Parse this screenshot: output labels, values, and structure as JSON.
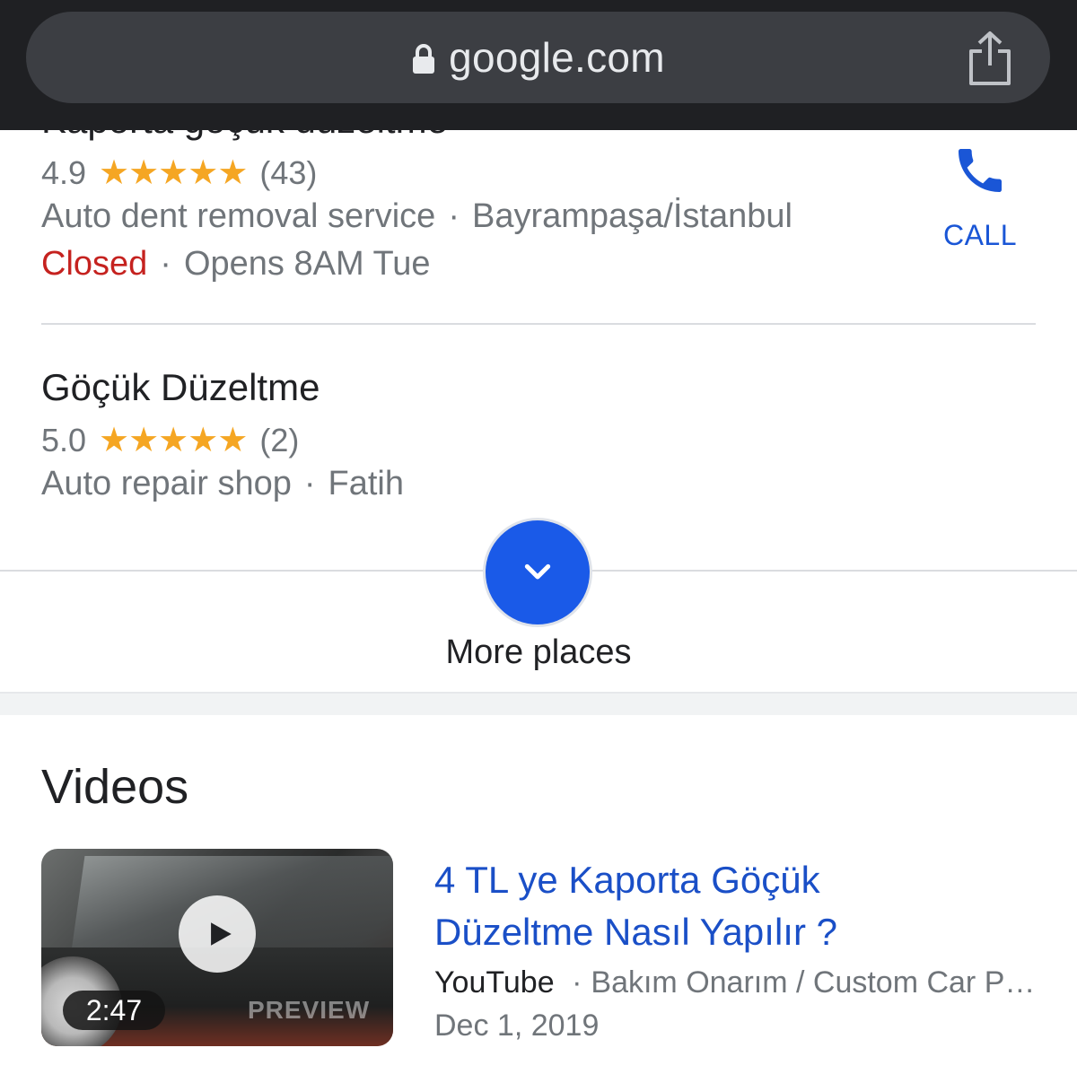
{
  "browser": {
    "url": "google.com"
  },
  "places": {
    "first": {
      "name": "Kaporta göçük düzeltme",
      "rating": "4.9",
      "stars": "★★★★★",
      "reviews": "(43)",
      "category": "Auto dent removal service",
      "location": "Bayrampaşa/İstanbul",
      "status": "Closed",
      "hours": "Opens 8AM Tue",
      "call_label": "CALL"
    },
    "second": {
      "name": "Göçük Düzeltme",
      "rating": "5.0",
      "stars": "★★★★★",
      "reviews": "(2)",
      "category": "Auto repair shop",
      "location": "Fatih"
    },
    "separator": "·",
    "more_label": "More places"
  },
  "videos": {
    "heading": "Videos",
    "items": [
      {
        "title": "4 TL ye Kaporta Göçük Düzeltme Nasıl Yapılır ?",
        "source": "YouTube",
        "channel": "Bakım Onarım / Custom Car P…",
        "date": "Dec 1, 2019",
        "duration": "2:47",
        "preview_label": "PREVIEW"
      }
    ]
  },
  "colors": {
    "accent_blue": "#1a5ae8",
    "closed_red": "#c5221f",
    "star_gold": "#f5a623",
    "link_blue": "#1a4fc7"
  },
  "icons": [
    "lock-icon",
    "share-icon",
    "phone-icon",
    "chevron-down-icon",
    "play-icon"
  ]
}
